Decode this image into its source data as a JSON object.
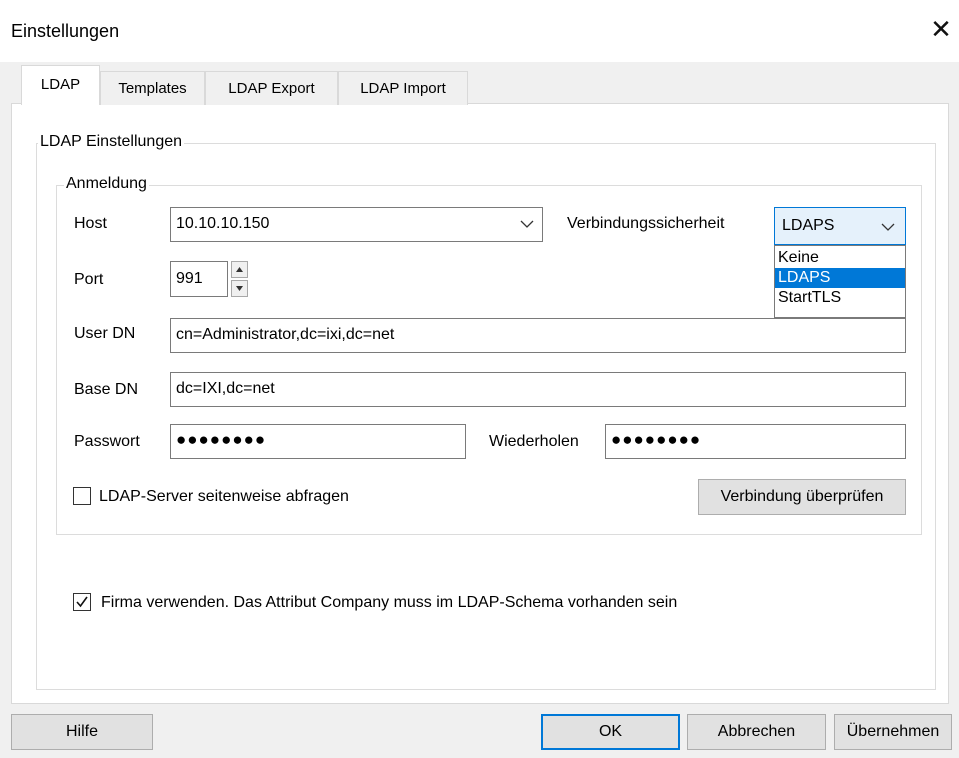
{
  "window": {
    "title": "Einstellungen"
  },
  "tabs": [
    {
      "label": "LDAP",
      "active": true
    },
    {
      "label": "Templates",
      "active": false
    },
    {
      "label": "LDAP Export",
      "active": false
    },
    {
      "label": "LDAP Import",
      "active": false
    }
  ],
  "ldap_group": {
    "label": "LDAP Einstellungen"
  },
  "login_group": {
    "label": "Anmeldung",
    "host_label": "Host",
    "host_value": "10.10.10.150",
    "security_label": "Verbindungssicherheit",
    "security_value": "LDAPS",
    "security_options": [
      "Keine",
      "LDAPS",
      "StartTLS"
    ],
    "security_selected_index": 1,
    "port_label": "Port",
    "port_value": "991",
    "userdn_label": "User DN",
    "userdn_value": "cn=Administrator,dc=ixi,dc=net",
    "basedn_label": "Base DN",
    "basedn_value": "dc=IXI,dc=net",
    "password_label": "Passwort",
    "password_value": "●●●●●●●●",
    "repeat_label": "Wiederholen",
    "repeat_value": "●●●●●●●●",
    "paging_label": "LDAP-Server seitenweise abfragen",
    "paging_checked": false,
    "test_button": "Verbindung überprüfen"
  },
  "company_check": {
    "label": "Firma verwenden. Das Attribut Company muss im LDAP-Schema vorhanden sein",
    "checked": true
  },
  "footer": {
    "help": "Hilfe",
    "ok": "OK",
    "cancel": "Abbrechen",
    "apply": "Übernehmen"
  },
  "colors": {
    "accent": "#0078d7",
    "button_face": "#e1e1e1",
    "window_bg": "#f0f0f0"
  }
}
